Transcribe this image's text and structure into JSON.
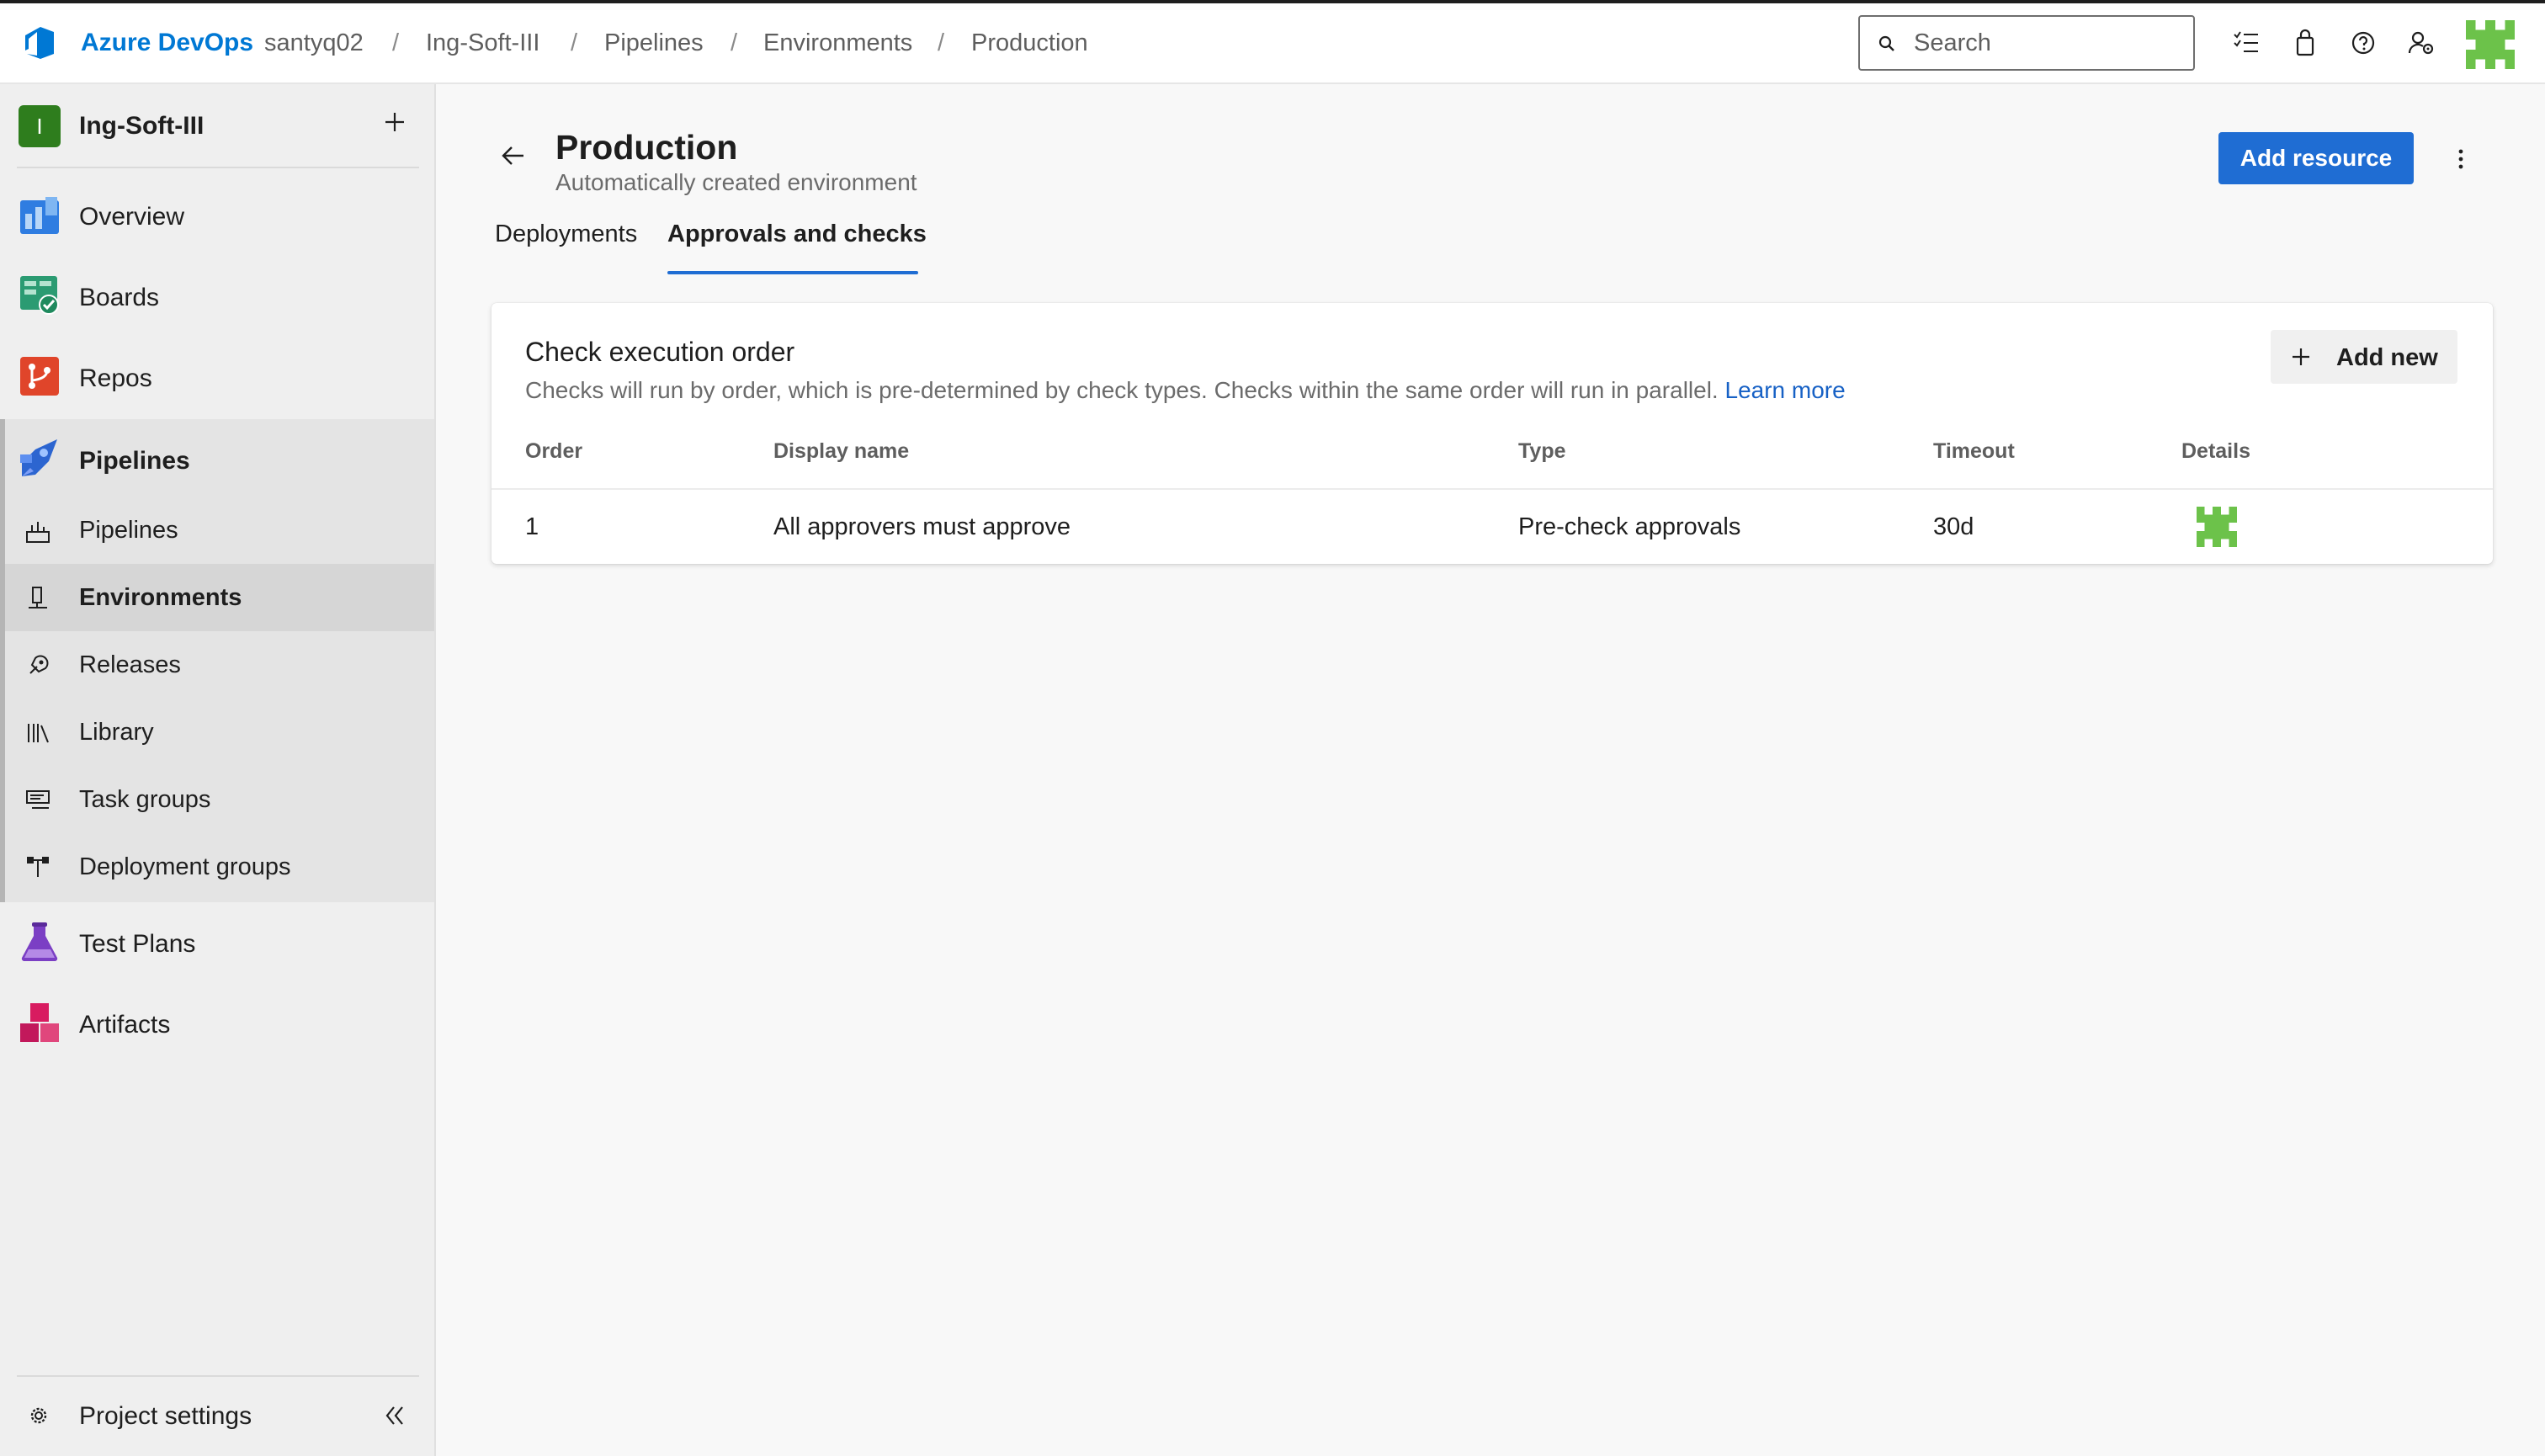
{
  "header": {
    "brand": "Azure DevOps",
    "breadcrumbs": [
      "santyq02",
      "Ing-Soft-III",
      "Pipelines",
      "Environments",
      "Production"
    ],
    "breadcrumb_separator": "/",
    "search_placeholder": "Search",
    "icons": [
      "task-list-icon",
      "shopping-bag-icon",
      "help-icon",
      "user-settings-icon",
      "user-avatar"
    ]
  },
  "sidebar": {
    "project_initial": "I",
    "project_name": "Ing-Soft-III",
    "items": [
      {
        "label": "Overview",
        "icon": "overview-icon"
      },
      {
        "label": "Boards",
        "icon": "boards-icon"
      },
      {
        "label": "Repos",
        "icon": "repos-icon"
      },
      {
        "label": "Pipelines",
        "icon": "pipelines-icon"
      }
    ],
    "pipelines_sub": [
      {
        "label": "Pipelines",
        "icon": "pipelines-sub-icon"
      },
      {
        "label": "Environments",
        "icon": "environments-icon",
        "active": true
      },
      {
        "label": "Releases",
        "icon": "releases-icon"
      },
      {
        "label": "Library",
        "icon": "library-icon"
      },
      {
        "label": "Task groups",
        "icon": "task-groups-icon"
      },
      {
        "label": "Deployment groups",
        "icon": "deployment-groups-icon"
      }
    ],
    "items_after": [
      {
        "label": "Test Plans",
        "icon": "test-plans-icon"
      },
      {
        "label": "Artifacts",
        "icon": "artifacts-icon"
      }
    ],
    "project_settings": "Project settings"
  },
  "page": {
    "title": "Production",
    "subtitle": "Automatically created environment",
    "add_resource": "Add resource",
    "tabs": [
      {
        "label": "Deployments",
        "active": false
      },
      {
        "label": "Approvals and checks",
        "active": true
      }
    ]
  },
  "card": {
    "title": "Check execution order",
    "description": "Checks will run by order, which is pre-determined by check types. Checks within the same order will run in parallel.",
    "learn_more": "Learn more",
    "add_new": "Add new",
    "columns": [
      "Order",
      "Display name",
      "Type",
      "Timeout",
      "Details"
    ],
    "rows": [
      {
        "order": "1",
        "display_name": "All approvers must approve",
        "type": "Pre-check approvals",
        "timeout": "30d",
        "details": "approver-avatar-icon"
      }
    ]
  },
  "colors": {
    "accent": "#1f6dd3",
    "brand": "#0078d4",
    "project_badge": "#2e7d1d",
    "avatar_green": "#6cc24a"
  }
}
